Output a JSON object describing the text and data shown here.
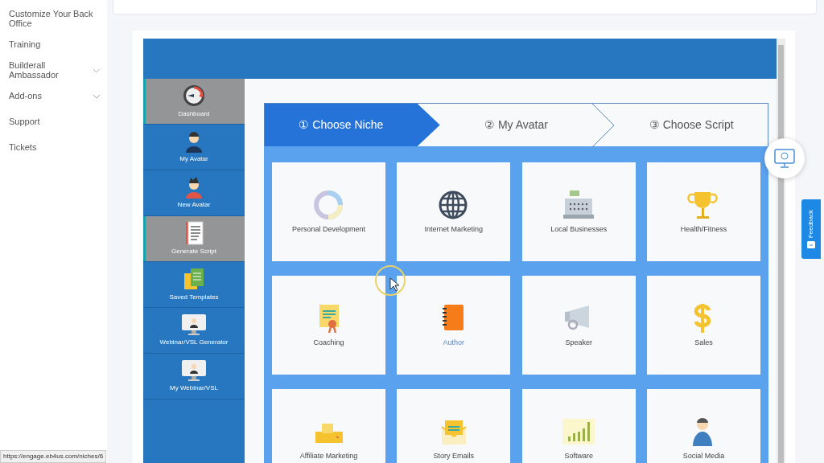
{
  "side_menu": [
    {
      "label": "Customize Your Back Office",
      "has_submenu": false
    },
    {
      "label": "Training",
      "has_submenu": false
    },
    {
      "label": "Builderall Ambassador",
      "has_submenu": true
    },
    {
      "label": "Add-ons",
      "has_submenu": true
    },
    {
      "label": "Support",
      "has_submenu": false
    },
    {
      "label": "Tickets",
      "has_submenu": false
    }
  ],
  "app_nav": [
    {
      "label": "Dashboard",
      "selected": true
    },
    {
      "label": "My Avatar",
      "selected": false
    },
    {
      "label": "New Avatar",
      "selected": false
    },
    {
      "label": "Generate Script",
      "selected": true
    },
    {
      "label": "Saved Templates",
      "selected": false
    },
    {
      "label": "Webinar/VSL Generator",
      "selected": false
    },
    {
      "label": "My Webinar/VSL",
      "selected": false
    }
  ],
  "steps": [
    {
      "number": "①",
      "label": "Choose Niche",
      "selected": true
    },
    {
      "number": "②",
      "label": "My Avatar",
      "selected": false
    },
    {
      "number": "③",
      "label": "Choose Script",
      "selected": false
    }
  ],
  "niches": [
    {
      "label": "Personal Development",
      "hovered": false
    },
    {
      "label": "Internet Marketing",
      "hovered": false
    },
    {
      "label": "Local Businesses",
      "hovered": false
    },
    {
      "label": "Health/Fitness",
      "hovered": false
    },
    {
      "label": "Coaching",
      "hovered": false
    },
    {
      "label": "Author",
      "hovered": true
    },
    {
      "label": "Speaker",
      "hovered": false
    },
    {
      "label": "Sales",
      "hovered": false
    },
    {
      "label": "Affiliate Marketing",
      "hovered": false
    },
    {
      "label": "Story Emails",
      "hovered": false
    },
    {
      "label": "Software",
      "hovered": false
    },
    {
      "label": "Social Media",
      "hovered": false
    }
  ],
  "feedback_tab": {
    "label": "Feedback"
  },
  "status_bar": {
    "url": "https://engage.eb4us.com/niches/6"
  }
}
